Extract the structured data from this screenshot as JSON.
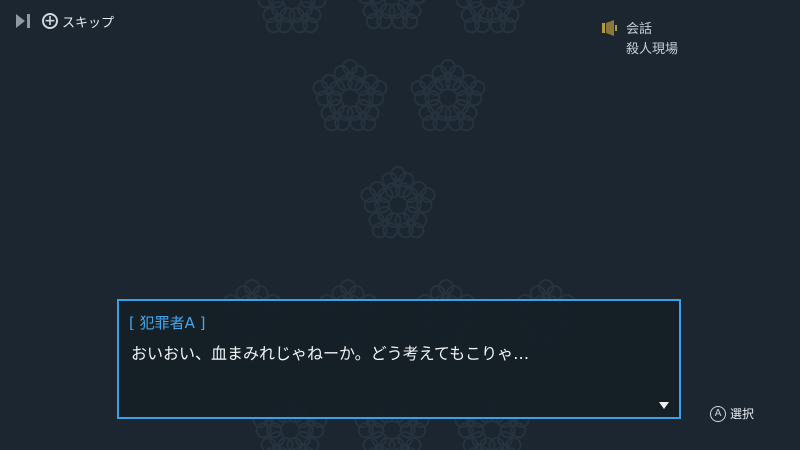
{
  "top_bar": {
    "skip_button_glyph": "+",
    "skip_label": "スキップ"
  },
  "location": {
    "type": "会話",
    "name": "殺人現場"
  },
  "dialogue": {
    "speaker": "[ 犯罪者A ]",
    "text": "おいおい、血まみれじゃねーか。どう考えてもこりゃ…"
  },
  "hint": {
    "button_glyph": "A",
    "label": "選択"
  },
  "colors": {
    "background": "#1b2630",
    "accent_blue": "#3aa0e8",
    "speaker_blue": "#43a6ee"
  },
  "icons": [
    "fast-forward-icon",
    "plus-button-icon",
    "conversation-icon",
    "next-arrow-icon",
    "a-button-icon"
  ]
}
